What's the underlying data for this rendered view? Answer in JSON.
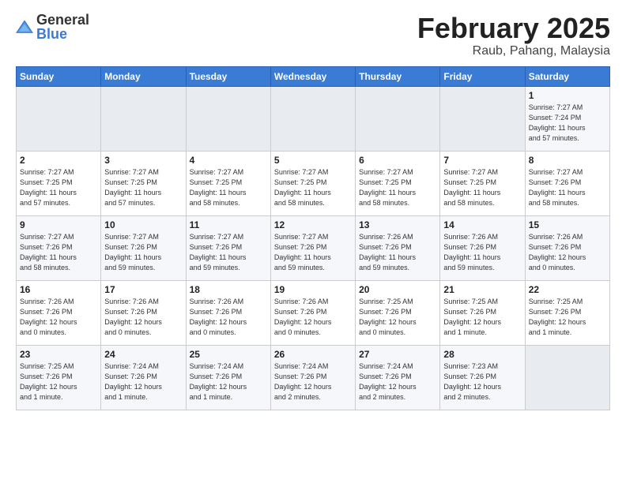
{
  "logo": {
    "general": "General",
    "blue": "Blue"
  },
  "header": {
    "month": "February 2025",
    "location": "Raub, Pahang, Malaysia"
  },
  "weekdays": [
    "Sunday",
    "Monday",
    "Tuesday",
    "Wednesday",
    "Thursday",
    "Friday",
    "Saturday"
  ],
  "weeks": [
    [
      {
        "day": "",
        "info": ""
      },
      {
        "day": "",
        "info": ""
      },
      {
        "day": "",
        "info": ""
      },
      {
        "day": "",
        "info": ""
      },
      {
        "day": "",
        "info": ""
      },
      {
        "day": "",
        "info": ""
      },
      {
        "day": "1",
        "info": "Sunrise: 7:27 AM\nSunset: 7:24 PM\nDaylight: 11 hours\nand 57 minutes."
      }
    ],
    [
      {
        "day": "2",
        "info": "Sunrise: 7:27 AM\nSunset: 7:25 PM\nDaylight: 11 hours\nand 57 minutes."
      },
      {
        "day": "3",
        "info": "Sunrise: 7:27 AM\nSunset: 7:25 PM\nDaylight: 11 hours\nand 57 minutes."
      },
      {
        "day": "4",
        "info": "Sunrise: 7:27 AM\nSunset: 7:25 PM\nDaylight: 11 hours\nand 58 minutes."
      },
      {
        "day": "5",
        "info": "Sunrise: 7:27 AM\nSunset: 7:25 PM\nDaylight: 11 hours\nand 58 minutes."
      },
      {
        "day": "6",
        "info": "Sunrise: 7:27 AM\nSunset: 7:25 PM\nDaylight: 11 hours\nand 58 minutes."
      },
      {
        "day": "7",
        "info": "Sunrise: 7:27 AM\nSunset: 7:25 PM\nDaylight: 11 hours\nand 58 minutes."
      },
      {
        "day": "8",
        "info": "Sunrise: 7:27 AM\nSunset: 7:26 PM\nDaylight: 11 hours\nand 58 minutes."
      }
    ],
    [
      {
        "day": "9",
        "info": "Sunrise: 7:27 AM\nSunset: 7:26 PM\nDaylight: 11 hours\nand 58 minutes."
      },
      {
        "day": "10",
        "info": "Sunrise: 7:27 AM\nSunset: 7:26 PM\nDaylight: 11 hours\nand 59 minutes."
      },
      {
        "day": "11",
        "info": "Sunrise: 7:27 AM\nSunset: 7:26 PM\nDaylight: 11 hours\nand 59 minutes."
      },
      {
        "day": "12",
        "info": "Sunrise: 7:27 AM\nSunset: 7:26 PM\nDaylight: 11 hours\nand 59 minutes."
      },
      {
        "day": "13",
        "info": "Sunrise: 7:26 AM\nSunset: 7:26 PM\nDaylight: 11 hours\nand 59 minutes."
      },
      {
        "day": "14",
        "info": "Sunrise: 7:26 AM\nSunset: 7:26 PM\nDaylight: 11 hours\nand 59 minutes."
      },
      {
        "day": "15",
        "info": "Sunrise: 7:26 AM\nSunset: 7:26 PM\nDaylight: 12 hours\nand 0 minutes."
      }
    ],
    [
      {
        "day": "16",
        "info": "Sunrise: 7:26 AM\nSunset: 7:26 PM\nDaylight: 12 hours\nand 0 minutes."
      },
      {
        "day": "17",
        "info": "Sunrise: 7:26 AM\nSunset: 7:26 PM\nDaylight: 12 hours\nand 0 minutes."
      },
      {
        "day": "18",
        "info": "Sunrise: 7:26 AM\nSunset: 7:26 PM\nDaylight: 12 hours\nand 0 minutes."
      },
      {
        "day": "19",
        "info": "Sunrise: 7:26 AM\nSunset: 7:26 PM\nDaylight: 12 hours\nand 0 minutes."
      },
      {
        "day": "20",
        "info": "Sunrise: 7:25 AM\nSunset: 7:26 PM\nDaylight: 12 hours\nand 0 minutes."
      },
      {
        "day": "21",
        "info": "Sunrise: 7:25 AM\nSunset: 7:26 PM\nDaylight: 12 hours\nand 1 minute."
      },
      {
        "day": "22",
        "info": "Sunrise: 7:25 AM\nSunset: 7:26 PM\nDaylight: 12 hours\nand 1 minute."
      }
    ],
    [
      {
        "day": "23",
        "info": "Sunrise: 7:25 AM\nSunset: 7:26 PM\nDaylight: 12 hours\nand 1 minute."
      },
      {
        "day": "24",
        "info": "Sunrise: 7:24 AM\nSunset: 7:26 PM\nDaylight: 12 hours\nand 1 minute."
      },
      {
        "day": "25",
        "info": "Sunrise: 7:24 AM\nSunset: 7:26 PM\nDaylight: 12 hours\nand 1 minute."
      },
      {
        "day": "26",
        "info": "Sunrise: 7:24 AM\nSunset: 7:26 PM\nDaylight: 12 hours\nand 2 minutes."
      },
      {
        "day": "27",
        "info": "Sunrise: 7:24 AM\nSunset: 7:26 PM\nDaylight: 12 hours\nand 2 minutes."
      },
      {
        "day": "28",
        "info": "Sunrise: 7:23 AM\nSunset: 7:26 PM\nDaylight: 12 hours\nand 2 minutes."
      },
      {
        "day": "",
        "info": ""
      }
    ]
  ]
}
